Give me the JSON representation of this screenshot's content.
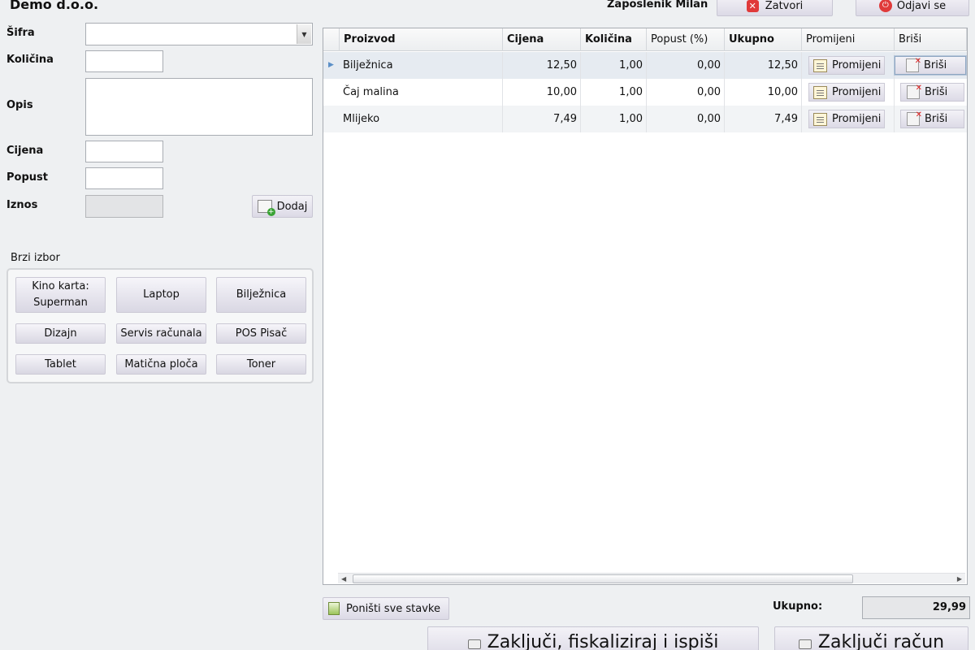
{
  "header": {
    "company": "Demo d.o.o.",
    "employee": "Zaposlenik Milan",
    "close_label": "Zatvori",
    "logout_label": "Odjavi se"
  },
  "form": {
    "sifra_label": "Šifra",
    "kolicina_label": "Količina",
    "opis_label": "Opis",
    "cijena_label": "Cijena",
    "popust_label": "Popust",
    "iznos_label": "Iznos",
    "add_label": "Dodaj"
  },
  "quick": {
    "title": "Brzi izbor",
    "items": [
      "Kino karta:\nSuperman",
      "Laptop",
      "Bilježnica",
      "Dizajn",
      "Servis računala",
      "POS Pisač",
      "Tablet",
      "Matična ploča",
      "Toner"
    ]
  },
  "grid": {
    "headers": {
      "product": "Proizvod",
      "price": "Cijena",
      "qty": "Količina",
      "discount": "Popust (%)",
      "total": "Ukupno",
      "edit": "Promijeni",
      "delete": "Briši"
    },
    "rows": [
      {
        "product": "Bilježnica",
        "price": "12,50",
        "qty": "1,00",
        "discount": "0,00",
        "total": "12,50",
        "edit": "Promijeni",
        "delete": "Briši"
      },
      {
        "product": "Čaj malina",
        "price": "10,00",
        "qty": "1,00",
        "discount": "0,00",
        "total": "10,00",
        "edit": "Promijeni",
        "delete": "Briši"
      },
      {
        "product": "Mlijeko",
        "price": "7,49",
        "qty": "1,00",
        "discount": "0,00",
        "total": "7,49",
        "edit": "Promijeni",
        "delete": "Briši"
      }
    ]
  },
  "footer": {
    "clear_label": "Poništi sve stavke",
    "total_label": "Ukupno:",
    "total_value": "29,99",
    "fiscalize_label": "Zaključi, fiskaliziraj i ispiši",
    "close_bill_label": "Zaključi račun"
  },
  "colors": {
    "background": "#eef0f2",
    "button_gradient_top": "#f3f2f7",
    "button_gradient_bottom": "#dcdae6",
    "accent_red": "#e03a3a",
    "selected_row": "#e6ebf1"
  }
}
